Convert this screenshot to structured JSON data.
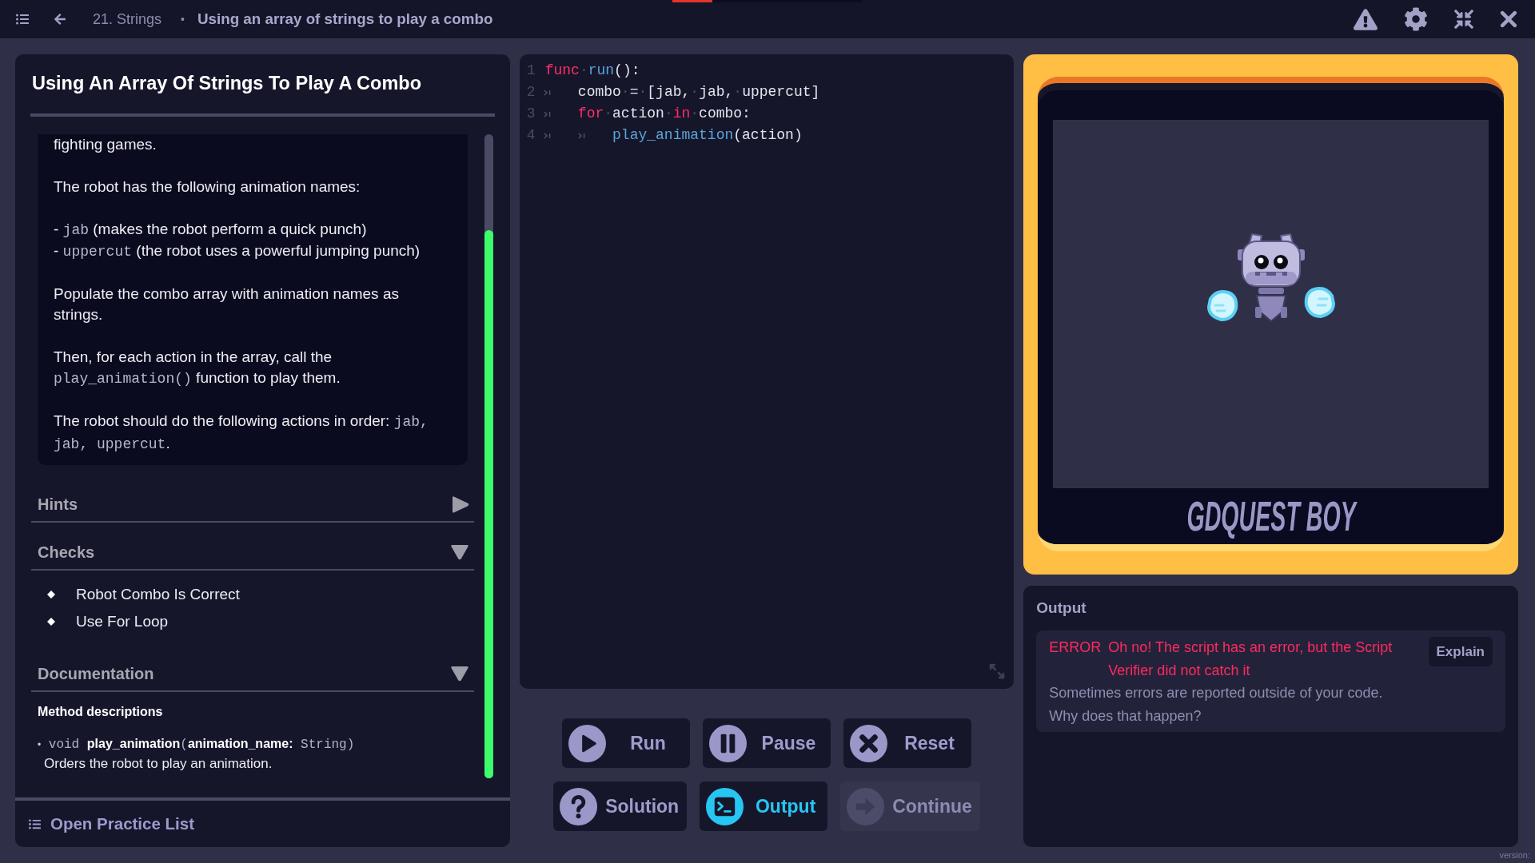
{
  "top_bar": {
    "chapter": "21. Strings",
    "separator": "•",
    "title": "Using an array of strings to play a combo",
    "progress": {
      "level": 0.21
    }
  },
  "lesson": {
    "title": "Using An Array Of Strings To Play A Combo",
    "description": [
      {
        "lines": [
          [
            {
              "kind": "text",
              "text": "fighting games."
            }
          ]
        ]
      },
      {
        "lines": [
          [
            {
              "kind": "text",
              "text": "The robot has the following animation names:"
            }
          ]
        ]
      },
      {
        "lines": [
          [
            {
              "kind": "text",
              "text": "- "
            },
            {
              "kind": "code",
              "text": "jab"
            },
            {
              "kind": "text",
              "text": " (makes the robot perform a quick punch)"
            }
          ],
          [
            {
              "kind": "text",
              "text": "- "
            },
            {
              "kind": "code",
              "text": "uppercut"
            },
            {
              "kind": "text",
              "text": " (the robot uses a powerful jumping punch)"
            }
          ]
        ]
      },
      {
        "lines": [
          [
            {
              "kind": "text",
              "text": "Populate the combo array with animation names as strings."
            }
          ]
        ]
      },
      {
        "lines": [
          [
            {
              "kind": "text",
              "text": "Then, for each action in the array, call the "
            },
            {
              "kind": "code",
              "text": "play_animation()"
            },
            {
              "kind": "text",
              "text": " function to play them."
            }
          ]
        ]
      },
      {
        "lines": [
          [
            {
              "kind": "text",
              "text": "The robot should do the following actions in order: "
            },
            {
              "kind": "code",
              "text": "jab, jab, uppercut"
            },
            {
              "kind": "text",
              "text": "."
            }
          ]
        ]
      }
    ],
    "sections": [
      {
        "kind": "hints",
        "title": "Hints",
        "expanded": false
      },
      {
        "kind": "checks",
        "title": "Checks",
        "expanded": true,
        "items": [
          "Robot Combo Is Correct",
          "Use For Loop"
        ]
      },
      {
        "kind": "documentation",
        "title": "Documentation",
        "expanded": true,
        "heading": "Method descriptions",
        "methods": [
          {
            "bullet": "•",
            "signature": [
              {
                "kind": "code",
                "text": " void "
              },
              {
                "kind": "bold",
                "text": "play_animation"
              },
              {
                "kind": "code",
                "text": "("
              },
              {
                "kind": "bold",
                "text": "animation_name:"
              },
              {
                "kind": "code",
                "text": " String)"
              }
            ],
            "description": "Orders the robot to play an animation."
          }
        ]
      }
    ],
    "footer": "Open Practice List"
  },
  "editor": {
    "lines": [
      {
        "number": "1",
        "tokens": [
          {
            "kind": "keyword",
            "text": "func"
          },
          {
            "kind": "space",
            "text": "·"
          },
          {
            "kind": "function",
            "text": "run"
          },
          {
            "kind": "plain",
            "text": "():"
          }
        ]
      },
      {
        "number": "2",
        "tokens": [
          {
            "kind": "tab"
          },
          {
            "kind": "plain",
            "text": "combo"
          },
          {
            "kind": "space",
            "text": "·"
          },
          {
            "kind": "plain",
            "text": "="
          },
          {
            "kind": "space",
            "text": "·"
          },
          {
            "kind": "plain",
            "text": "[jab,"
          },
          {
            "kind": "space",
            "text": "·"
          },
          {
            "kind": "plain",
            "text": "jab,"
          },
          {
            "kind": "space",
            "text": "·"
          },
          {
            "kind": "plain",
            "text": "uppercut]"
          }
        ]
      },
      {
        "number": "3",
        "tokens": [
          {
            "kind": "tab"
          },
          {
            "kind": "keyword",
            "text": "for"
          },
          {
            "kind": "space",
            "text": "·"
          },
          {
            "kind": "plain",
            "text": "action"
          },
          {
            "kind": "space",
            "text": "·"
          },
          {
            "kind": "keyword",
            "text": "in"
          },
          {
            "kind": "space",
            "text": "·"
          },
          {
            "kind": "plain",
            "text": "combo:"
          }
        ]
      },
      {
        "number": "4",
        "tokens": [
          {
            "kind": "tab"
          },
          {
            "kind": "tab"
          },
          {
            "kind": "function",
            "text": "play_animation"
          },
          {
            "kind": "plain",
            "text": "(action)"
          }
        ]
      }
    ]
  },
  "control_rows": [
    [
      {
        "kind": "run",
        "label": "Run",
        "active": false,
        "disabled": false
      },
      {
        "kind": "pause",
        "label": "Pause",
        "active": false,
        "disabled": false
      },
      {
        "kind": "reset",
        "label": "Reset",
        "active": false,
        "disabled": false
      }
    ],
    [
      {
        "kind": "solution",
        "label": "Solution",
        "active": false,
        "disabled": false
      },
      {
        "kind": "output",
        "label": "Output",
        "active": true,
        "disabled": false
      },
      {
        "kind": "continue",
        "label": "Continue",
        "active": false,
        "disabled": true
      }
    ]
  ],
  "game": {
    "console_label": "GDQUEST BOY"
  },
  "output": {
    "title": "Output",
    "messages": [
      {
        "kind": "error",
        "tag": "ERROR",
        "text": "Oh no! The script has an error, but the Script Verifier did not catch it"
      }
    ],
    "notes": [
      "Sometimes errors are reported outside of your code.",
      "Why does that happen?"
    ],
    "explain_button": "Explain"
  },
  "version": "version:"
}
